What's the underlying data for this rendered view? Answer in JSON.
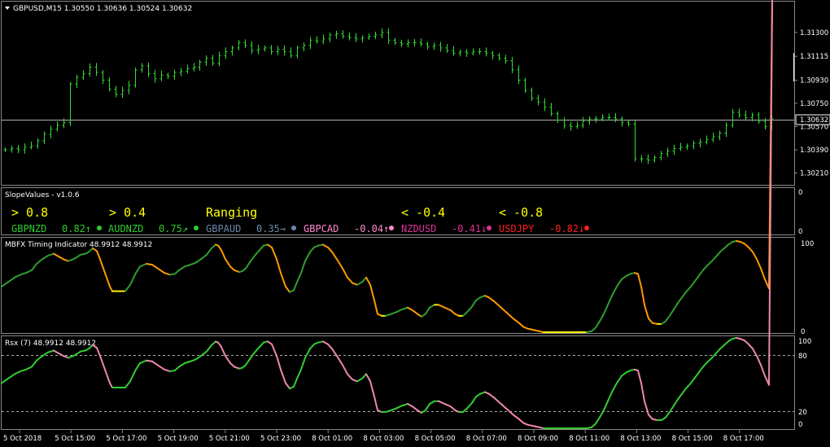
{
  "main": {
    "header": "GBPUSD,M15  1.30550 1.30636 1.30524 1.30632",
    "yticks": [
      "1.31300",
      "1.31115",
      "1.30930",
      "1.30750",
      "1.30570",
      "1.30390",
      "1.30210"
    ],
    "current_price": "1.30632"
  },
  "slope": {
    "title": "SlopeValues - v1.0.6",
    "levels": [
      "> 0.8",
      "> 0.4",
      "Ranging",
      "< -0.4",
      "< -0.8"
    ],
    "pairs": [
      {
        "pair": "GBPNZD",
        "value": "0.82",
        "arrow": "↑",
        "color": "#2ecc2e"
      },
      {
        "pair": "AUDNZD",
        "value": "0.75",
        "arrow": "↗",
        "color": "#2ecc2e"
      },
      {
        "pair": "GBPAUD",
        "value": "0.35",
        "arrow": "→",
        "color": "#6a8aa8"
      },
      {
        "pair": "GBPCAD",
        "value": "-0.04",
        "arrow": "↑",
        "color": "#ff88cc"
      },
      {
        "pair": "NZDUSD",
        "value": "-0.41",
        "arrow": "↓",
        "color": "#dd3399"
      },
      {
        "pair": "USDJPY",
        "value": "-0.82",
        "arrow": "↓",
        "color": "#ff2020"
      }
    ],
    "yticks": [
      "0",
      "0"
    ]
  },
  "mbfx": {
    "title": "MBFX Timing Indicator 48.9912 48.9912",
    "yticks": [
      "100",
      "0"
    ]
  },
  "rsx": {
    "title": "Rsx (7) 48.9912 48.9912",
    "yticks": [
      "100",
      "80",
      "20",
      "0"
    ]
  },
  "xaxis": {
    "labels": [
      "5 Oct 2018",
      "5 Oct 15:00",
      "5 Oct 17:00",
      "5 Oct 19:00",
      "5 Oct 21:00",
      "5 Oct 23:00",
      "8 Oct 01:00",
      "8 Oct 03:00",
      "8 Oct 05:00",
      "8 Oct 07:00",
      "8 Oct 09:00",
      "8 Oct 11:00",
      "8 Oct 13:00",
      "8 Oct 15:00",
      "8 Oct 17:00"
    ]
  },
  "chart_data": [
    {
      "type": "ohlc",
      "title": "GBPUSD,M15",
      "ylim": [
        1.3015,
        1.314
      ],
      "closes": [
        1.3039,
        1.304,
        1.3039,
        1.3041,
        1.3042,
        1.3046,
        1.3051,
        1.3055,
        1.3058,
        1.306,
        1.309,
        1.3095,
        1.3098,
        1.3103,
        1.3099,
        1.3093,
        1.3086,
        1.3082,
        1.3085,
        1.3089,
        1.3101,
        1.3104,
        1.3098,
        1.3094,
        1.3097,
        1.3096,
        1.3099,
        1.31,
        1.3102,
        1.3103,
        1.3107,
        1.311,
        1.3106,
        1.3112,
        1.3115,
        1.3118,
        1.3122,
        1.312,
        1.3116,
        1.3117,
        1.3118,
        1.3115,
        1.3117,
        1.3115,
        1.3112,
        1.3118,
        1.312,
        1.3124,
        1.3123,
        1.3125,
        1.3128,
        1.3129,
        1.3127,
        1.3126,
        1.3125,
        1.3126,
        1.3127,
        1.3128,
        1.313,
        1.3124,
        1.3122,
        1.3121,
        1.3122,
        1.3122,
        1.3121,
        1.3119,
        1.312,
        1.3118,
        1.3116,
        1.3114,
        1.3115,
        1.3114,
        1.3115,
        1.3115,
        1.3114,
        1.3112,
        1.311,
        1.3108,
        1.3101,
        1.3093,
        1.3085,
        1.3079,
        1.3076,
        1.3072,
        1.3067,
        1.3062,
        1.3058,
        1.3057,
        1.3058,
        1.3061,
        1.3063,
        1.3063,
        1.3064,
        1.3064,
        1.3063,
        1.306,
        1.3059,
        1.3032,
        1.3032,
        1.3031,
        1.3033,
        1.3036,
        1.3038,
        1.304,
        1.3041,
        1.3042,
        1.3044,
        1.3045,
        1.3047,
        1.3049,
        1.3052,
        1.3058,
        1.3068,
        1.3066,
        1.3064,
        1.3066,
        1.3061,
        1.3057,
        1.3063
      ]
    },
    {
      "type": "line",
      "title": "MBFX Timing Indicator",
      "ylim": [
        0,
        100
      ],
      "x": [
        0,
        8,
        16,
        23,
        30,
        37,
        43,
        50,
        57,
        64,
        70,
        76,
        82,
        88,
        92,
        97,
        103,
        107,
        112,
        117,
        121,
        127,
        133,
        136,
        140,
        145,
        152,
        158,
        165,
        170,
        178,
        185,
        190,
        195,
        200,
        207,
        213,
        218,
        225,
        232,
        238,
        245,
        252,
        258,
        263,
        266,
        270,
        275,
        281,
        286,
        292,
        296,
        300,
        306,
        312,
        317,
        322,
        327,
        332,
        338,
        343,
        349,
        354,
        359,
        363,
        368,
        373,
        379,
        384,
        389,
        395,
        401,
        406,
        412,
        419,
        425,
        431,
        437,
        443,
        448,
        453,
        458,
        462,
        467,
        472,
        479,
        485,
        492,
        499,
        505,
        511,
        516,
        521,
        526,
        532,
        537,
        542,
        547,
        552,
        557,
        562,
        567,
        572,
        578,
        583,
        588,
        594,
        599,
        605,
        610,
        615,
        620,
        625,
        630,
        636,
        641,
        646,
        651,
        656,
        661,
        666,
        671,
        676,
        681,
        686,
        691,
        697,
        702,
        707,
        713,
        719,
        725,
        730,
        735,
        740,
        745,
        750,
        756,
        762,
        768,
        773,
        778,
        782,
        786,
        790,
        795,
        800,
        806,
        811,
        816,
        821,
        826,
        831,
        836,
        841,
        847,
        852,
        857,
        862,
        867,
        873,
        878,
        883,
        888,
        893,
        898,
        903,
        908,
        913,
        918,
        923,
        928,
        933,
        938,
        943,
        947
      ],
      "values": [
        50,
        55,
        60,
        63,
        65,
        68,
        75,
        80,
        84,
        86,
        83,
        80,
        78,
        80,
        82,
        85,
        86,
        88,
        92,
        89,
        80,
        65,
        50,
        45,
        45,
        45,
        45,
        52,
        65,
        72,
        75,
        74,
        71,
        68,
        65,
        63,
        64,
        68,
        72,
        74,
        76,
        80,
        85,
        92,
        96,
        95,
        90,
        80,
        72,
        68,
        66,
        67,
        70,
        78,
        85,
        90,
        95,
        96,
        93,
        80,
        65,
        50,
        44,
        46,
        55,
        65,
        78,
        88,
        93,
        95,
        96,
        93,
        88,
        80,
        70,
        60,
        54,
        52,
        55,
        60,
        52,
        35,
        20,
        18,
        18,
        20,
        22,
        25,
        27,
        24,
        20,
        17,
        20,
        27,
        30,
        30,
        28,
        26,
        24,
        20,
        18,
        18,
        22,
        28,
        35,
        38,
        40,
        38,
        34,
        30,
        26,
        22,
        18,
        14,
        10,
        6,
        4,
        3,
        2,
        1,
        0,
        0,
        0,
        0,
        0,
        0,
        0,
        0,
        0,
        0,
        0,
        1,
        5,
        12,
        20,
        30,
        40,
        50,
        58,
        62,
        64,
        65,
        64,
        50,
        30,
        15,
        10,
        9,
        9,
        12,
        18,
        25,
        32,
        38,
        44,
        50,
        56,
        62,
        68,
        73,
        78,
        83,
        88,
        92,
        96,
        99,
        100,
        99,
        97,
        93,
        88,
        80,
        70,
        58,
        48
      ]
    },
    {
      "type": "line",
      "title": "Rsx (7)",
      "ylim": [
        0,
        100
      ],
      "hlines": [
        80,
        20
      ],
      "x": [
        0,
        8,
        16,
        23,
        30,
        37,
        43,
        50,
        57,
        64,
        70,
        76,
        82,
        88,
        92,
        97,
        103,
        107,
        112,
        117,
        121,
        127,
        133,
        136,
        140,
        145,
        152,
        158,
        165,
        170,
        178,
        185,
        190,
        195,
        200,
        207,
        213,
        218,
        225,
        232,
        238,
        245,
        252,
        258,
        263,
        266,
        270,
        275,
        281,
        286,
        292,
        296,
        300,
        306,
        312,
        317,
        322,
        327,
        332,
        338,
        343,
        349,
        354,
        359,
        363,
        368,
        373,
        379,
        384,
        389,
        395,
        401,
        406,
        412,
        419,
        425,
        431,
        437,
        443,
        448,
        453,
        458,
        462,
        467,
        472,
        479,
        485,
        492,
        499,
        505,
        511,
        516,
        521,
        526,
        532,
        537,
        542,
        547,
        552,
        557,
        562,
        567,
        572,
        578,
        583,
        588,
        594,
        599,
        605,
        610,
        615,
        620,
        625,
        630,
        636,
        641,
        646,
        651,
        656,
        661,
        666,
        671,
        676,
        681,
        686,
        691,
        697,
        702,
        707,
        713,
        719,
        725,
        730,
        735,
        740,
        745,
        750,
        756,
        762,
        768,
        773,
        778,
        782,
        786,
        790,
        795,
        800,
        806,
        811,
        816,
        821,
        826,
        831,
        836,
        841,
        847,
        852,
        857,
        862,
        867,
        873,
        878,
        883,
        888,
        893,
        898,
        903,
        908,
        913,
        918,
        923,
        928,
        933,
        938,
        943,
        947
      ],
      "values": [
        50,
        55,
        60,
        63,
        65,
        68,
        75,
        80,
        84,
        86,
        83,
        80,
        78,
        80,
        82,
        85,
        86,
        88,
        92,
        89,
        80,
        65,
        50,
        45,
        45,
        45,
        45,
        52,
        65,
        72,
        75,
        74,
        71,
        68,
        65,
        63,
        64,
        68,
        72,
        74,
        76,
        80,
        85,
        92,
        96,
        95,
        90,
        80,
        72,
        68,
        66,
        67,
        70,
        78,
        85,
        90,
        95,
        96,
        93,
        80,
        65,
        50,
        44,
        46,
        55,
        65,
        78,
        88,
        93,
        95,
        96,
        93,
        88,
        80,
        70,
        60,
        54,
        52,
        55,
        60,
        52,
        35,
        20,
        18,
        18,
        20,
        22,
        25,
        27,
        24,
        20,
        17,
        20,
        27,
        30,
        30,
        28,
        26,
        24,
        20,
        18,
        18,
        22,
        28,
        35,
        38,
        40,
        38,
        34,
        30,
        26,
        22,
        18,
        14,
        10,
        6,
        4,
        3,
        2,
        1,
        0,
        0,
        0,
        0,
        0,
        0,
        0,
        0,
        0,
        0,
        0,
        1,
        5,
        12,
        20,
        30,
        40,
        50,
        58,
        62,
        64,
        65,
        64,
        50,
        30,
        15,
        10,
        9,
        9,
        12,
        18,
        25,
        32,
        38,
        44,
        50,
        56,
        62,
        68,
        73,
        78,
        83,
        88,
        92,
        96,
        99,
        100,
        99,
        97,
        93,
        88,
        80,
        70,
        58,
        48
      ]
    }
  ]
}
